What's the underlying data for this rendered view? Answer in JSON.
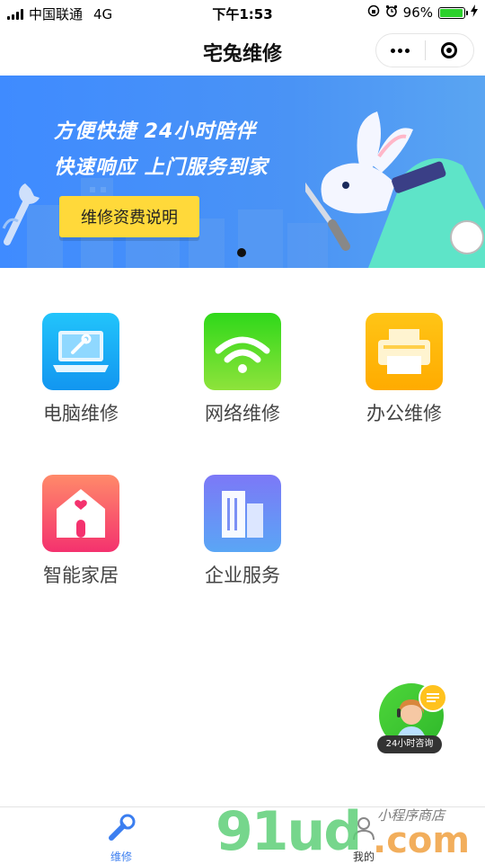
{
  "status_bar": {
    "carrier": "中国联通",
    "network": "4G",
    "time": "下午1:53",
    "battery_percent": "96%",
    "battery_level": 0.96
  },
  "nav": {
    "title": "宅兔维修"
  },
  "banner": {
    "line1": "方便快捷 24小时陪伴",
    "line2": "快速响应 上门服务到家",
    "button": "维修资费说明",
    "active_slide": 1,
    "slide_count": 1
  },
  "services": [
    {
      "label": "电脑维修",
      "icon": "laptop-wrench-icon",
      "color": "#1aa7f5"
    },
    {
      "label": "网络维修",
      "icon": "wifi-icon",
      "color": "#3fcf25"
    },
    {
      "label": "办公维修",
      "icon": "printer-icon",
      "color": "#ffb300"
    },
    {
      "label": "智能家居",
      "icon": "home-heart-icon",
      "color": "#f2476a"
    },
    {
      "label": "企业服务",
      "icon": "building-icon",
      "color": "#6d7ff5"
    }
  ],
  "consult": {
    "label": "24小时咨询"
  },
  "tabs": [
    {
      "label": "维修",
      "icon": "wrench-icon",
      "active": true
    },
    {
      "label": "我的",
      "icon": "user-icon",
      "active": false
    }
  ],
  "watermark": {
    "brand": "91ud",
    "suffix": ".com",
    "script": "小程序商店"
  },
  "colors": {
    "accent": "#3b7ef0",
    "banner": "#4a93f5",
    "banner_button": "#ffd93a"
  }
}
